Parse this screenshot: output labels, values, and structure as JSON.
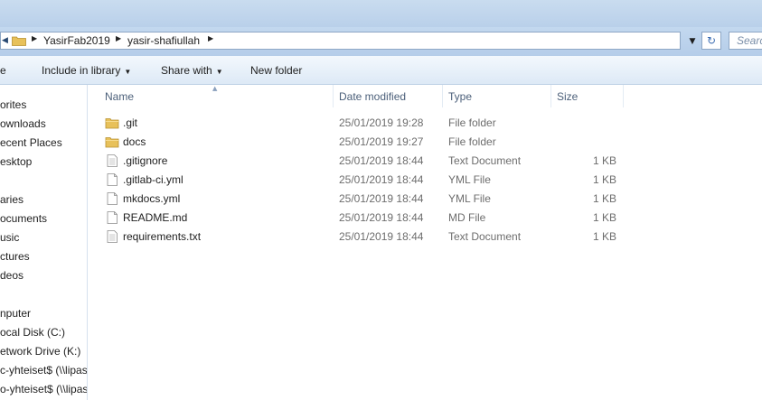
{
  "address": {
    "crumbs": [
      "YasirFab2019",
      "yasir-shafiullah"
    ],
    "search_placeholder": "Search"
  },
  "toolbar": {
    "organize_label": "e",
    "include_label": "Include in library",
    "share_label": "Share with",
    "newfolder_label": "New folder"
  },
  "nav": {
    "items": [
      "orites",
      "ownloads",
      "ecent Places",
      "esktop",
      "aries",
      "ocuments",
      "usic",
      "ctures",
      "deos",
      "nputer",
      "ocal Disk (C:)",
      "etwork Drive (K:)",
      "c-yhteiset$ (\\\\lipas",
      "o-yhteiset$ (\\\\lipas"
    ]
  },
  "columns": {
    "name": "Name",
    "date": "Date modified",
    "type": "Type",
    "size": "Size"
  },
  "files": [
    {
      "name": ".git",
      "date": "25/01/2019 19:28",
      "type": "File folder",
      "size": "",
      "icon": "folder-icon"
    },
    {
      "name": "docs",
      "date": "25/01/2019 19:27",
      "type": "File folder",
      "size": "",
      "icon": "folder-icon"
    },
    {
      "name": ".gitignore",
      "date": "25/01/2019 18:44",
      "type": "Text Document",
      "size": "1 KB",
      "icon": "text-file-icon"
    },
    {
      "name": ".gitlab-ci.yml",
      "date": "25/01/2019 18:44",
      "type": "YML File",
      "size": "1 KB",
      "icon": "file-icon"
    },
    {
      "name": "mkdocs.yml",
      "date": "25/01/2019 18:44",
      "type": "YML File",
      "size": "1 KB",
      "icon": "file-icon"
    },
    {
      "name": "README.md",
      "date": "25/01/2019 18:44",
      "type": "MD File",
      "size": "1 KB",
      "icon": "file-icon"
    },
    {
      "name": "requirements.txt",
      "date": "25/01/2019 18:44",
      "type": "Text Document",
      "size": "1 KB",
      "icon": "text-file-icon"
    }
  ],
  "colors": {
    "header_text": "#4c607a",
    "meta_text": "#6d6d6d",
    "folder": "#e8c15a"
  }
}
